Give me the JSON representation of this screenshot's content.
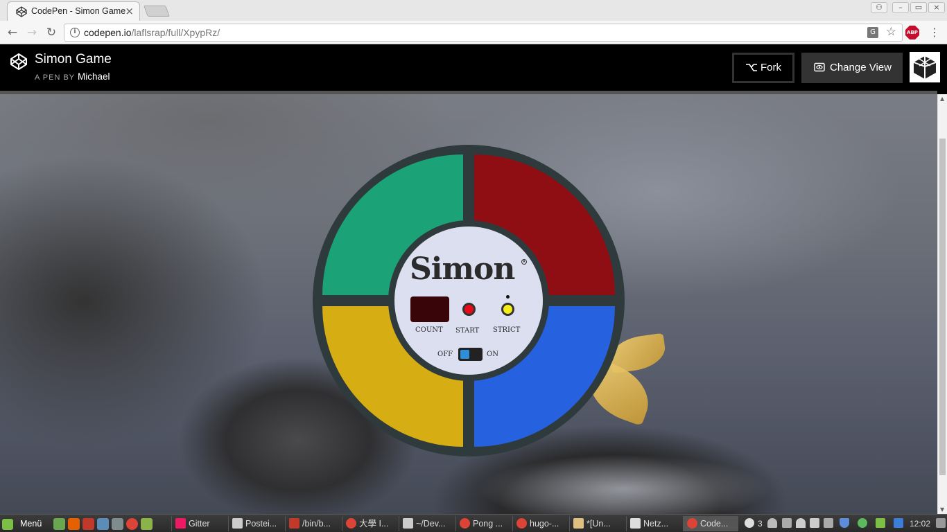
{
  "browser": {
    "tab_title": "CodePen - Simon Game",
    "url_domain": "codepen.io",
    "url_path": "/laflsrap/full/XpypRz/",
    "abp_label": "ABP"
  },
  "codepen": {
    "title": "Simon Game",
    "by_label": "A PEN BY",
    "author": "Michael",
    "fork_label": "Fork",
    "change_view_label": "Change View"
  },
  "game": {
    "brand": "Simon",
    "count_label": "COUNT",
    "start_label": "START",
    "strict_label": "STRICT",
    "off_label": "OFF",
    "on_label": "ON",
    "power": "off",
    "colors": {
      "green": "#1ca277",
      "red": "#8e0e13",
      "yellow": "#d6ad12",
      "blue": "#2662e0"
    }
  },
  "taskbar": {
    "menu_label": "Menü",
    "tasks": [
      "Gitter",
      "Postei...",
      "/bin/b...",
      "大學 I...",
      "~/Dev...",
      "Pong ...",
      "hugo-...",
      "*[Un...",
      "Netz...",
      "Code..."
    ],
    "notification_count": "3",
    "clock": "12:02"
  }
}
